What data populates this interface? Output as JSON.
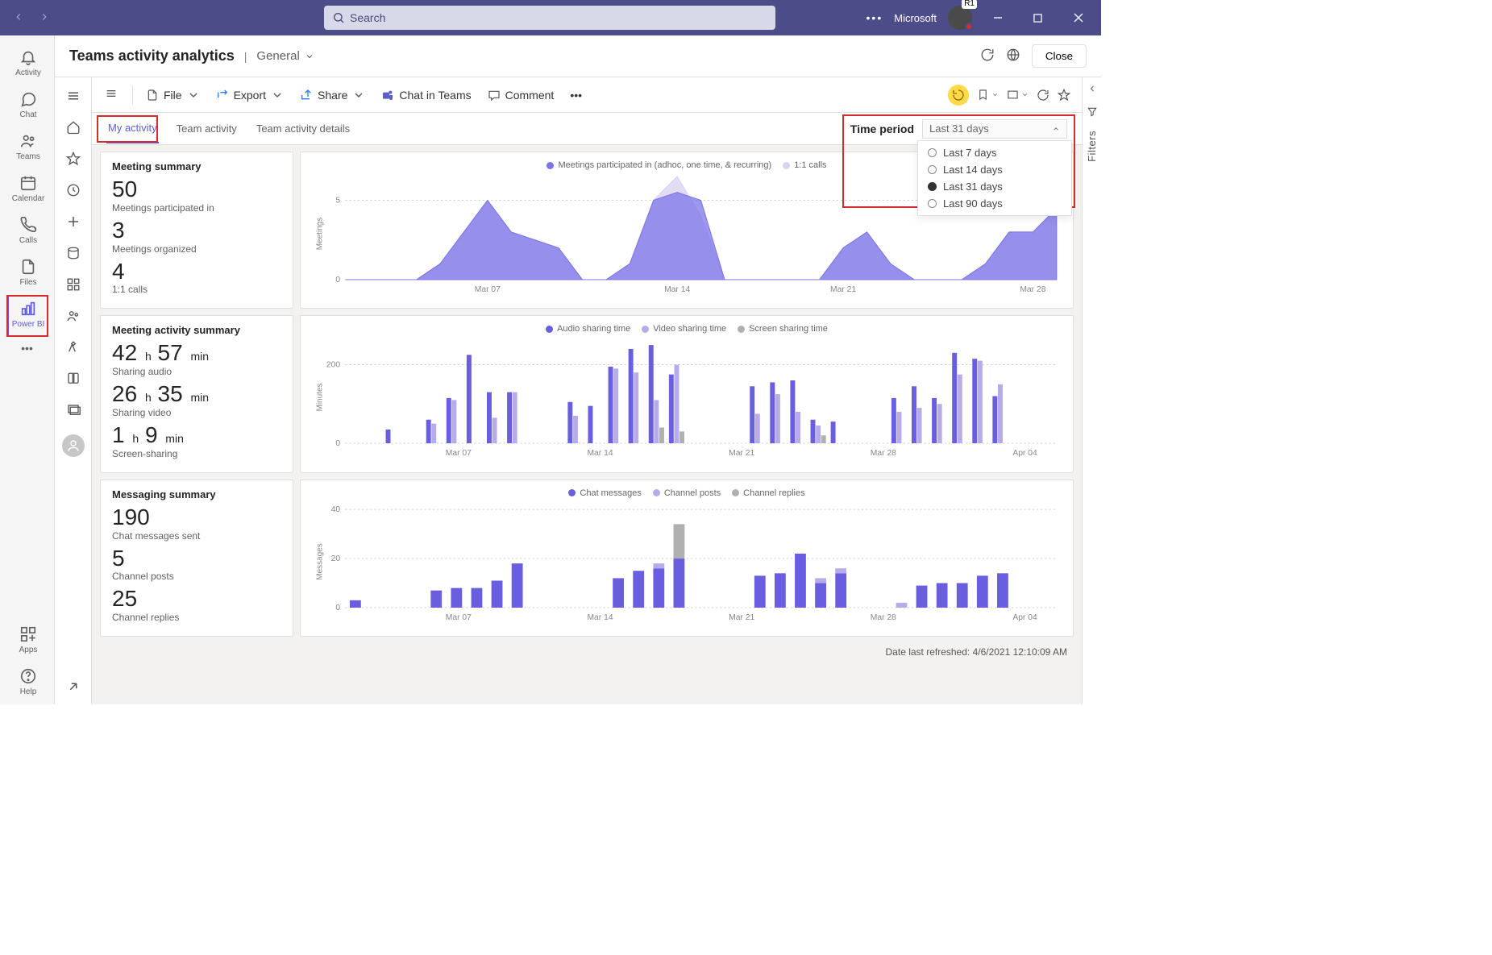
{
  "titlebar": {
    "search_placeholder": "Search",
    "tenant": "Microsoft",
    "avatar_badge": "R1"
  },
  "rail": [
    {
      "key": "activity",
      "label": "Activity"
    },
    {
      "key": "chat",
      "label": "Chat"
    },
    {
      "key": "teams",
      "label": "Teams"
    },
    {
      "key": "calendar",
      "label": "Calendar"
    },
    {
      "key": "calls",
      "label": "Calls"
    },
    {
      "key": "files",
      "label": "Files"
    },
    {
      "key": "powerbi",
      "label": "Power BI",
      "selected": true,
      "highlight": true
    }
  ],
  "rail_bottom": [
    {
      "key": "apps",
      "label": "Apps"
    },
    {
      "key": "help",
      "label": "Help"
    }
  ],
  "header": {
    "title": "Teams activity analytics",
    "channel": "General",
    "close": "Close"
  },
  "toolbar": {
    "file": "File",
    "export": "Export",
    "share": "Share",
    "chat": "Chat in Teams",
    "comment": "Comment"
  },
  "tabs": {
    "items": [
      "My activity",
      "Team activity",
      "Team activity details"
    ],
    "activeIndex": 0,
    "period_label": "Time period",
    "period_value": "Last 31 days",
    "period_options": [
      "Last 7 days",
      "Last 14 days",
      "Last 31 days",
      "Last 90 days"
    ],
    "period_selected": 2
  },
  "filters_label": "Filters",
  "cards": {
    "meeting": {
      "title": "Meeting summary",
      "m1_val": "50",
      "m1_lbl": "Meetings participated in",
      "m2_val": "3",
      "m2_lbl": "Meetings organized",
      "m3_val": "4",
      "m3_lbl": "1:1 calls"
    },
    "activity": {
      "title": "Meeting activity summary",
      "a1_v1": "42",
      "a1_u1": "h",
      "a1_v2": "57",
      "a1_u2": "min",
      "a1_lbl": "Sharing audio",
      "a2_v1": "26",
      "a2_u1": "h",
      "a2_v2": "35",
      "a2_u2": "min",
      "a2_lbl": "Sharing video",
      "a3_v1": "1",
      "a3_u1": "h",
      "a3_v2": "9",
      "a3_u2": "min",
      "a3_lbl": "Screen-sharing"
    },
    "messaging": {
      "title": "Messaging summary",
      "c1_val": "190",
      "c1_lbl": "Chat messages sent",
      "c2_val": "5",
      "c2_lbl": "Channel posts",
      "c3_val": "25",
      "c3_lbl": "Channel replies"
    }
  },
  "legends": {
    "meetings": [
      "Meetings participated in (adhoc, one time, & recurring)",
      "1:1 calls"
    ],
    "minutes": [
      "Audio sharing time",
      "Video sharing time",
      "Screen sharing time"
    ],
    "messages": [
      "Chat messages",
      "Channel posts",
      "Channel replies"
    ]
  },
  "axis": {
    "xticks": [
      "Mar 07",
      "Mar 14",
      "Mar 21",
      "Mar 28"
    ],
    "xrightB": "Apr 04",
    "meetings_ylabel": "Meetings",
    "minutes_ylabel": "Minutes",
    "messages_ylabel": "Messages"
  },
  "refreshed": "Date last refreshed: 4/6/2021 12:10:09 AM",
  "chart_data": [
    {
      "id": "meetings",
      "type": "area",
      "x": [
        1,
        2,
        3,
        4,
        5,
        6,
        7,
        8,
        9,
        10,
        11,
        12,
        13,
        14,
        15,
        16,
        17,
        18,
        19,
        20,
        21,
        22,
        23,
        24,
        25,
        26,
        27,
        28,
        29,
        30,
        31
      ],
      "series": [
        {
          "name": "Meetings participated in (adhoc, one time, & recurring)",
          "color": "#7c74e8",
          "values": [
            0,
            0,
            0,
            0,
            1,
            3,
            5,
            3,
            2.5,
            2,
            0,
            0,
            1,
            5,
            5.5,
            5,
            0,
            0,
            0,
            0,
            0,
            2,
            3,
            1,
            0,
            0,
            0,
            1,
            3,
            3,
            4.5
          ]
        },
        {
          "name": "1:1 calls",
          "color": "#d8d1f2",
          "values": [
            0,
            0,
            0,
            0,
            1,
            3,
            5,
            3,
            2.5,
            2,
            0,
            0,
            1,
            5,
            6.5,
            4,
            0,
            0,
            0,
            0,
            0,
            2,
            3,
            1,
            0,
            0,
            0,
            1,
            3,
            3,
            4.5
          ]
        }
      ],
      "ylabel": "Meetings",
      "yticks": [
        0,
        5
      ],
      "xticks": [
        "Mar 07",
        "Mar 14",
        "Mar 21",
        "Mar 28"
      ]
    },
    {
      "id": "minutes",
      "type": "bar",
      "x": [
        1,
        2,
        3,
        4,
        5,
        6,
        7,
        8,
        9,
        10,
        11,
        12,
        13,
        14,
        15,
        16,
        17,
        18,
        19,
        20,
        21,
        22,
        23,
        24,
        25,
        26,
        27,
        28,
        29,
        30,
        31,
        32,
        33,
        34,
        35
      ],
      "series": [
        {
          "name": "Audio sharing time",
          "color": "#6a5ee0",
          "values": [
            0,
            0,
            35,
            0,
            60,
            115,
            225,
            130,
            130,
            0,
            0,
            105,
            95,
            195,
            240,
            250,
            175,
            0,
            0,
            0,
            145,
            155,
            160,
            60,
            55,
            0,
            0,
            115,
            145,
            115,
            230,
            215,
            120,
            0,
            0
          ]
        },
        {
          "name": "Video sharing time",
          "color": "#b7abe9",
          "values": [
            0,
            0,
            0,
            0,
            50,
            110,
            0,
            65,
            130,
            0,
            0,
            70,
            0,
            190,
            180,
            110,
            200,
            0,
            0,
            0,
            75,
            125,
            80,
            45,
            0,
            0,
            0,
            80,
            90,
            100,
            175,
            210,
            150,
            0,
            0
          ]
        },
        {
          "name": "Screen sharing time",
          "color": "#b0b0b0",
          "values": [
            0,
            0,
            0,
            0,
            0,
            0,
            0,
            0,
            0,
            0,
            0,
            0,
            0,
            0,
            0,
            40,
            30,
            0,
            0,
            0,
            0,
            0,
            0,
            20,
            0,
            0,
            0,
            0,
            0,
            0,
            0,
            0,
            0,
            0,
            0
          ]
        }
      ],
      "ylabel": "Minutes",
      "yticks": [
        0,
        200
      ],
      "xticks": [
        "Mar 07",
        "Mar 14",
        "Mar 21",
        "Mar 28",
        "Apr 04"
      ]
    },
    {
      "id": "messages",
      "type": "bar-stacked",
      "x": [
        1,
        2,
        3,
        4,
        5,
        6,
        7,
        8,
        9,
        10,
        11,
        12,
        13,
        14,
        15,
        16,
        17,
        18,
        19,
        20,
        21,
        22,
        23,
        24,
        25,
        26,
        27,
        28,
        29,
        30,
        31,
        32,
        33,
        34,
        35
      ],
      "series": [
        {
          "name": "Chat messages",
          "color": "#6a5ee0",
          "values": [
            3,
            0,
            0,
            0,
            7,
            8,
            8,
            11,
            18,
            0,
            0,
            0,
            0,
            12,
            15,
            16,
            20,
            0,
            0,
            0,
            13,
            14,
            22,
            10,
            14,
            0,
            0,
            0,
            9,
            10,
            10,
            13,
            14,
            0,
            0
          ]
        },
        {
          "name": "Channel posts",
          "color": "#b7abe9",
          "values": [
            0,
            0,
            0,
            0,
            0,
            0,
            0,
            0,
            0,
            0,
            0,
            0,
            0,
            0,
            0,
            2,
            0,
            0,
            0,
            0,
            0,
            0,
            0,
            2,
            2,
            0,
            0,
            2,
            0,
            0,
            0,
            0,
            0,
            0,
            0
          ]
        },
        {
          "name": "Channel replies",
          "color": "#b0b0b0",
          "values": [
            0,
            0,
            0,
            0,
            0,
            0,
            0,
            0,
            0,
            0,
            0,
            0,
            0,
            0,
            0,
            0,
            14,
            0,
            0,
            0,
            0,
            0,
            0,
            0,
            0,
            0,
            0,
            0,
            0,
            0,
            0,
            0,
            0,
            0,
            0
          ]
        }
      ],
      "ylabel": "Messages",
      "yticks": [
        0,
        20,
        40
      ],
      "xticks": [
        "Mar 07",
        "Mar 14",
        "Mar 21",
        "Mar 28",
        "Apr 04"
      ]
    }
  ]
}
